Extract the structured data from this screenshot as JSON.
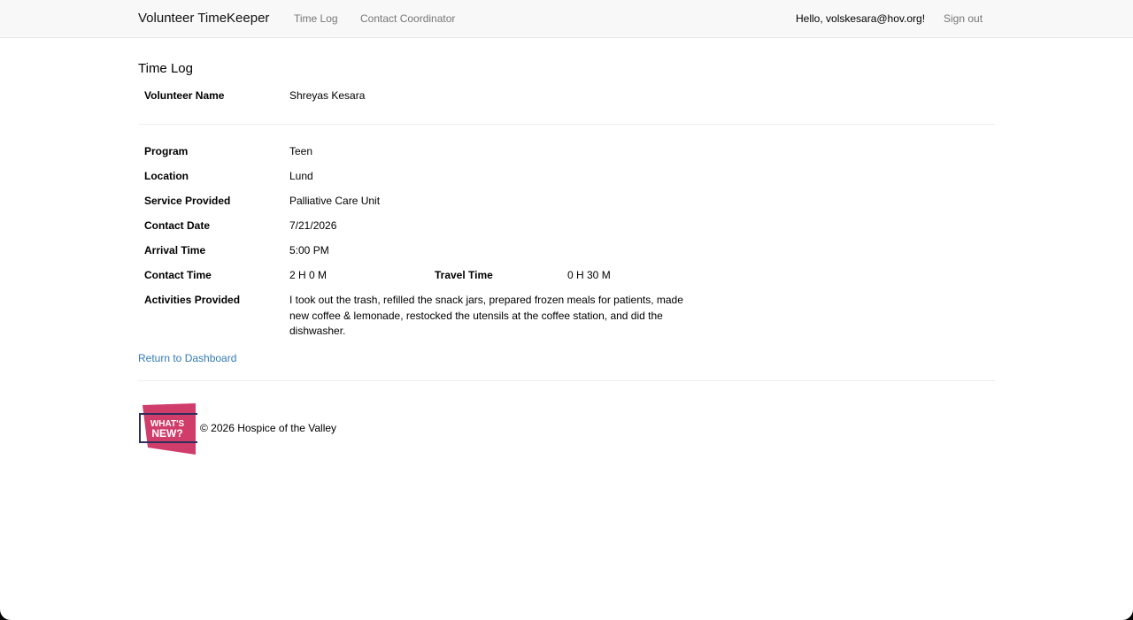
{
  "nav": {
    "brand": "Volunteer TimeKeeper",
    "links": [
      "Time Log",
      "Contact Coordinator"
    ],
    "greeting": "Hello, volskesara@hov.org!",
    "signout": "Sign out"
  },
  "page": {
    "title": "Time Log",
    "volunteer_label": "Volunteer Name",
    "volunteer_name": "Shreyas Kesara",
    "fields": [
      {
        "label": "Program",
        "value": "Teen"
      },
      {
        "label": "Location",
        "value": "Lund"
      },
      {
        "label": "Service Provided",
        "value": "Palliative Care Unit"
      },
      {
        "label": "Contact Date",
        "value": "7/21/2026"
      },
      {
        "label": "Arrival Time",
        "value": "5:00 PM"
      }
    ],
    "contact_time_label": "Contact Time",
    "contact_time_value": "2 H 0 M",
    "travel_time_label": "Travel Time",
    "travel_time_value": "0 H 30 M",
    "activities_label": "Activities Provided",
    "activities_value": "I took out the trash, refilled the snack jars, prepared frozen meals for patients, made new coffee & lemonade, restocked the utensils at the coffee station, and did the dishwasher.",
    "return_link": "Return to Dashboard"
  },
  "footer": {
    "logo_line1": "WHAT'S",
    "logo_line2": "NEW?",
    "copyright": "© 2026 Hospice of the Valley",
    "logo_color": "#d13d6b"
  }
}
